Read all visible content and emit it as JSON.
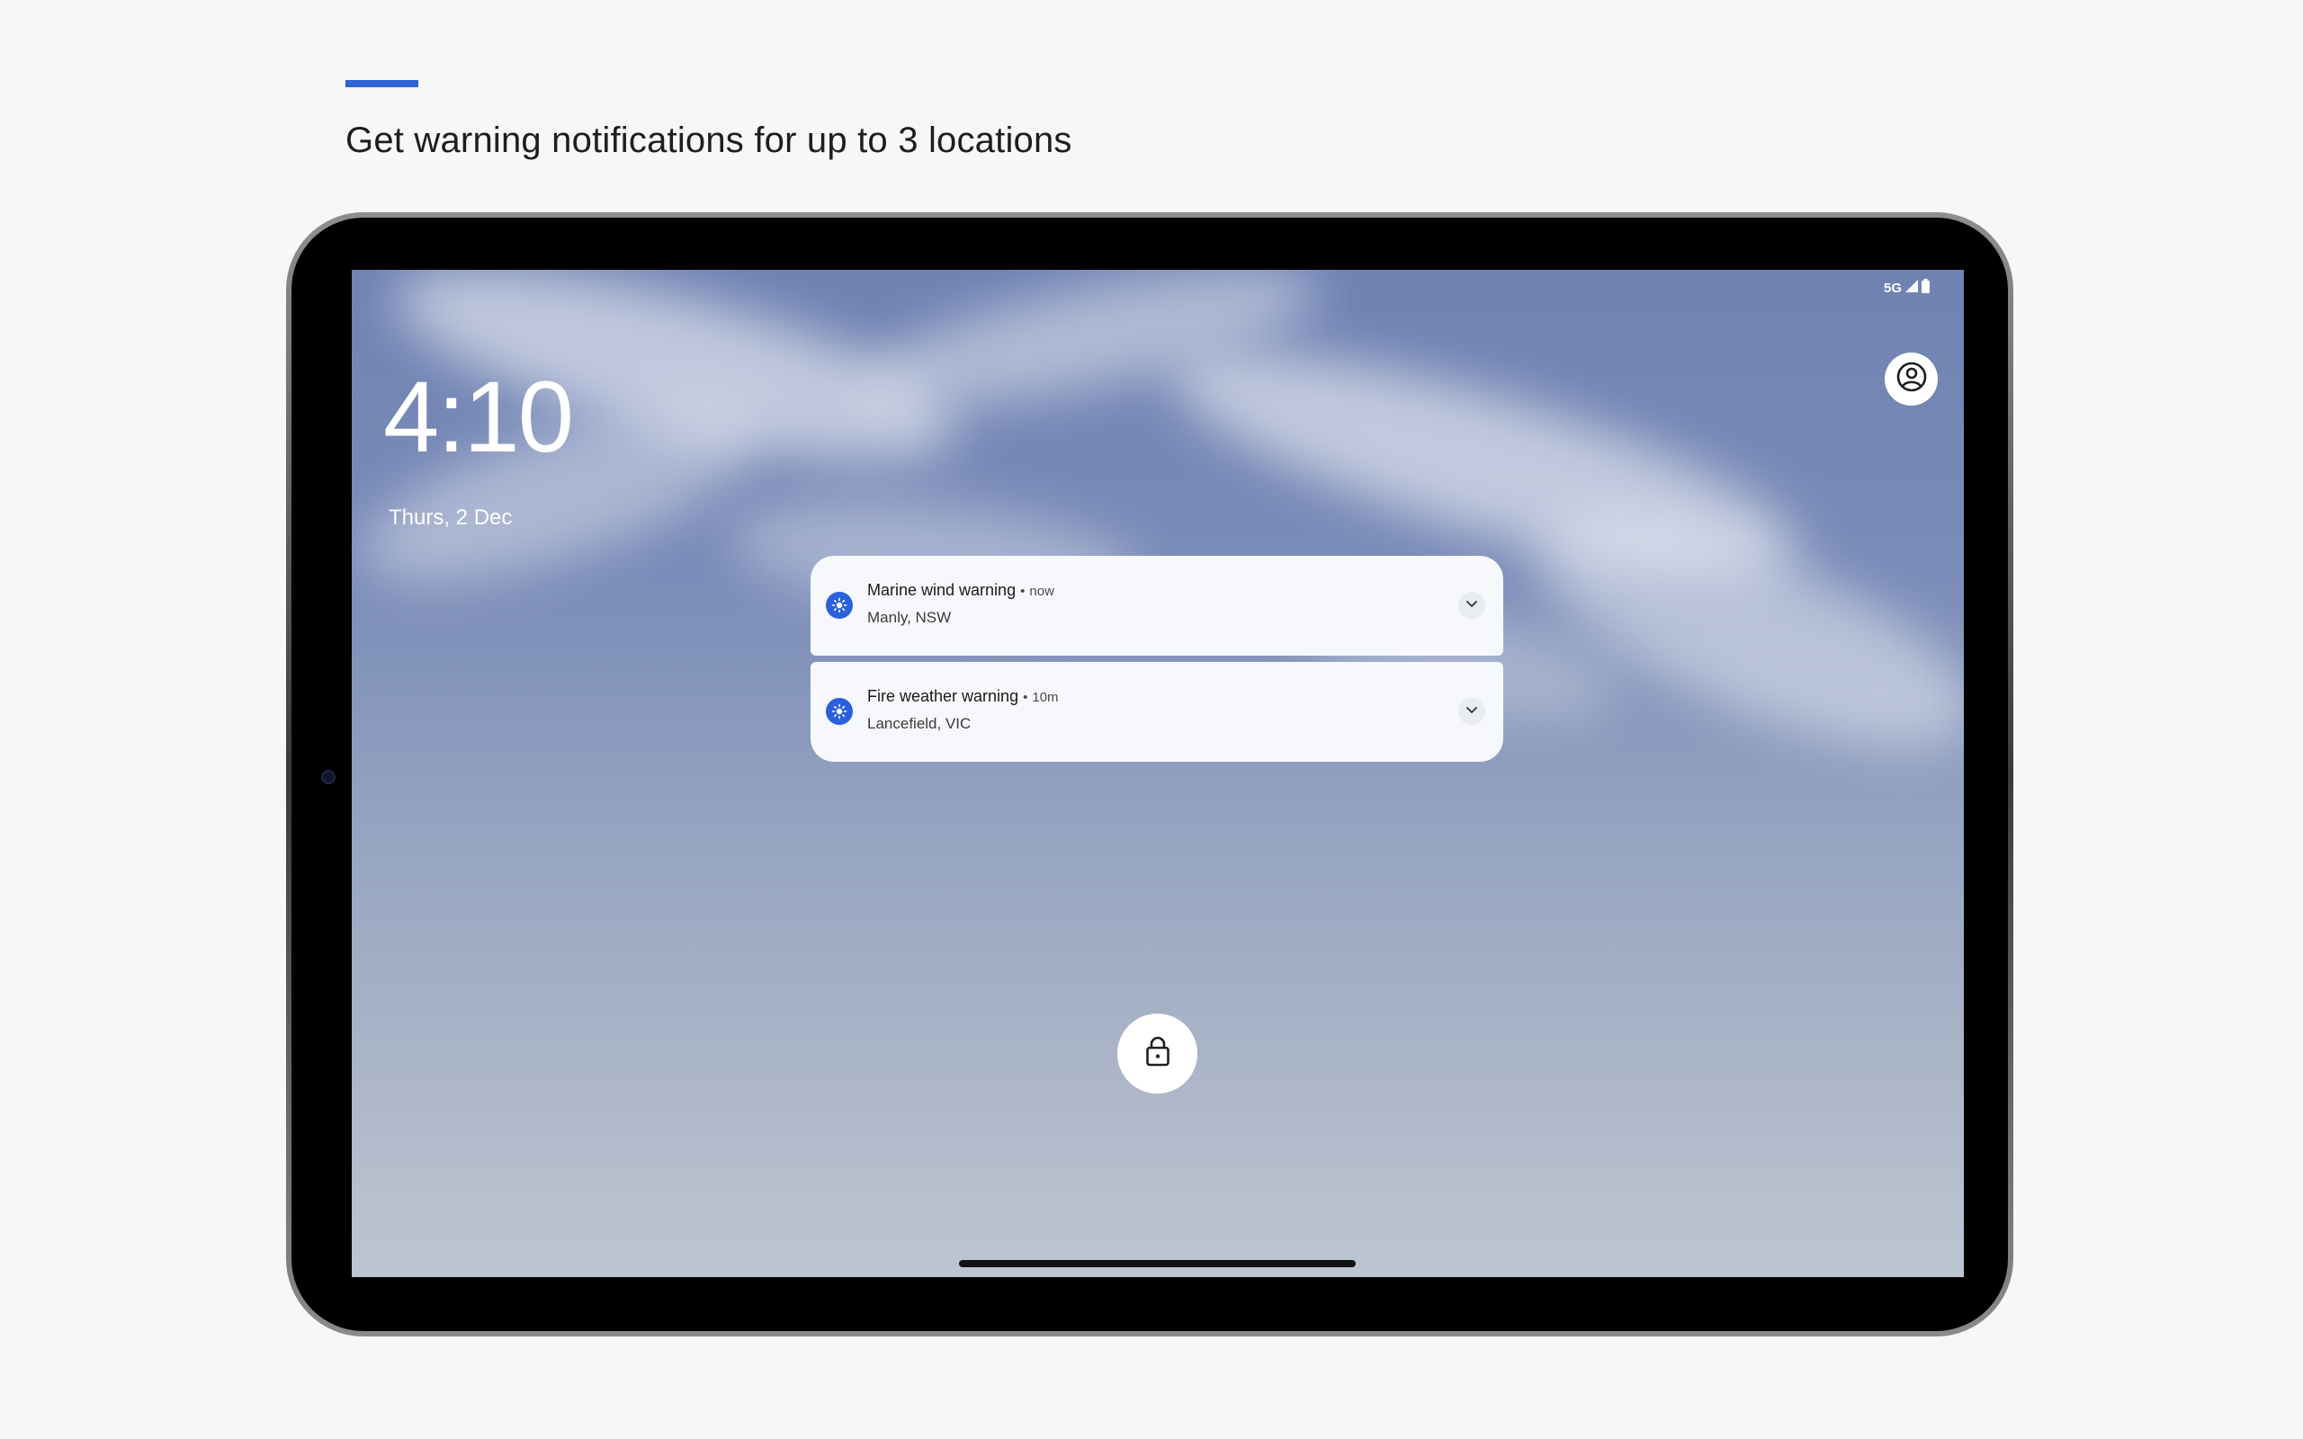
{
  "header": {
    "headline": "Get warning notifications for up to 3 locations",
    "accent_color": "#2f63d6"
  },
  "status_bar": {
    "network": "5G",
    "icons": [
      "signal-icon",
      "battery-icon"
    ]
  },
  "lock_screen": {
    "time": "4:10",
    "date": "Thurs, 2 Dec",
    "user_icon": "account-circle-icon",
    "lock_icon": "lock-icon"
  },
  "notifications": [
    {
      "title": "Marine wind warning",
      "separator": "•",
      "time": "now",
      "location": "Manly, NSW",
      "icon": "sun-icon",
      "icon_color": "#2a60db"
    },
    {
      "title": "Fire weather warning",
      "separator": "•",
      "time": "10m",
      "location": "Lancefield, VIC",
      "icon": "sun-icon",
      "icon_color": "#2a60db"
    }
  ]
}
